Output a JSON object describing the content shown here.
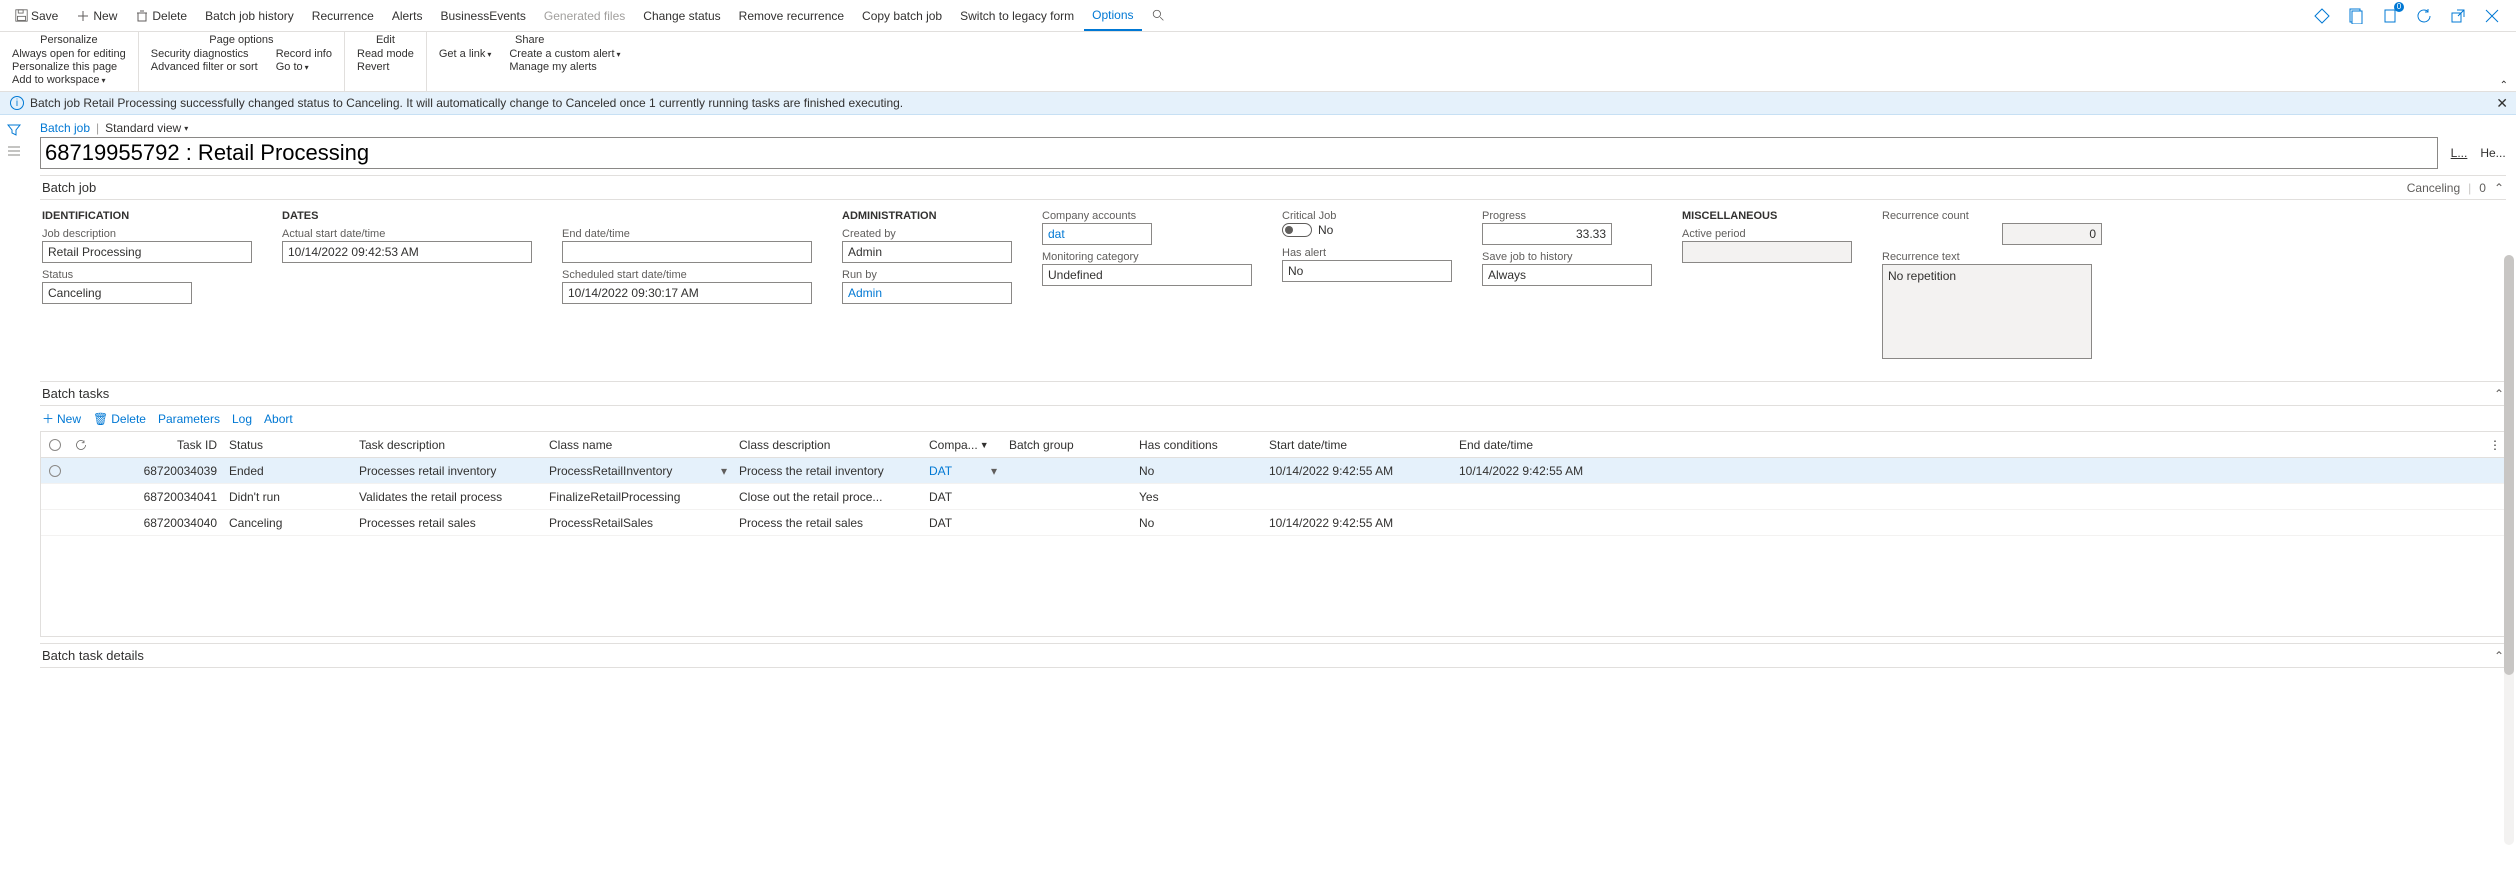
{
  "actionbar": {
    "save": "Save",
    "new": "New",
    "delete": "Delete",
    "history": "Batch job history",
    "recurrence": "Recurrence",
    "alerts": "Alerts",
    "businessEvents": "BusinessEvents",
    "generatedFiles": "Generated files",
    "changeStatus": "Change status",
    "removeRecurrence": "Remove recurrence",
    "copy": "Copy batch job",
    "switch": "Switch to legacy form",
    "options": "Options"
  },
  "ribbon": {
    "personalize": {
      "title": "Personalize",
      "alwaysOpen": "Always open for editing",
      "personalizePage": "Personalize this page",
      "addWorkspace": "Add to workspace"
    },
    "pageOptions": {
      "title": "Page options",
      "securityDiag": "Security diagnostics",
      "advancedFilter": "Advanced filter or sort",
      "recordInfo": "Record info",
      "goTo": "Go to"
    },
    "edit": {
      "title": "Edit",
      "readMode": "Read mode",
      "revert": "Revert"
    },
    "share": {
      "title": "Share",
      "getLink": "Get a link",
      "customAlert": "Create a custom alert",
      "manageAlerts": "Manage my alerts"
    }
  },
  "message": "Batch job Retail Processing successfully changed status to Canceling. It will automatically change to Canceled once 1 currently running tasks are finished executing.",
  "breadcrumb": {
    "link": "Batch job",
    "view": "Standard view"
  },
  "title": "68719955792 : Retail Processing",
  "titleActions": {
    "lookup": "L...",
    "help": "He..."
  },
  "fasttab1": {
    "title": "Batch job",
    "summaryStatus": "Canceling",
    "summaryCount": "0",
    "identification": {
      "head": "IDENTIFICATION",
      "jobDescLabel": "Job description",
      "jobDesc": "Retail Processing",
      "statusLabel": "Status",
      "status": "Canceling"
    },
    "dates": {
      "head": "DATES",
      "actualLabel": "Actual start date/time",
      "actual": "10/14/2022 09:42:53 AM",
      "endLabel": "End date/time",
      "end": "",
      "scheduledLabel": "Scheduled start date/time",
      "scheduled": "10/14/2022 09:30:17 AM"
    },
    "admin": {
      "head": "ADMINISTRATION",
      "createdByLabel": "Created by",
      "createdBy": "Admin",
      "runByLabel": "Run by",
      "runBy": "Admin",
      "companyLabel": "Company accounts",
      "company": "dat",
      "monitoringLabel": "Monitoring category",
      "monitoring": "Undefined",
      "criticalLabel": "Critical Job",
      "criticalVal": "No",
      "hasAlertLabel": "Has alert",
      "hasAlert": "No",
      "progressLabel": "Progress",
      "progress": "33.33",
      "saveLogLabel": "Save job to history",
      "saveLog": "Always"
    },
    "misc": {
      "head": "MISCELLANEOUS",
      "activePeriodLabel": "Active period",
      "activePeriod": "",
      "recurCountLabel": "Recurrence count",
      "recurCount": "0",
      "recurTextLabel": "Recurrence text",
      "recurText": "No repetition"
    }
  },
  "batchTasks": {
    "title": "Batch tasks",
    "toolbar": {
      "new": "New",
      "delete": "Delete",
      "parameters": "Parameters",
      "log": "Log",
      "abort": "Abort"
    },
    "columns": {
      "taskId": "Task ID",
      "status": "Status",
      "taskDesc": "Task description",
      "className": "Class name",
      "classDesc": "Class description",
      "company": "Compa...",
      "batchGroup": "Batch group",
      "hasCond": "Has conditions",
      "start": "Start date/time",
      "end": "End date/time"
    },
    "rows": [
      {
        "taskId": "68720034039",
        "status": "Ended",
        "taskDesc": "Processes retail inventory",
        "className": "ProcessRetailInventory",
        "classDesc": "Process the retail inventory",
        "company": "DAT",
        "batchGroup": "",
        "hasCond": "No",
        "start": "10/14/2022 9:42:55 AM",
        "end": "10/14/2022 9:42:55 AM"
      },
      {
        "taskId": "68720034041",
        "status": "Didn't run",
        "taskDesc": "Validates the retail process",
        "className": "FinalizeRetailProcessing",
        "classDesc": "Close out the retail proce...",
        "company": "DAT",
        "batchGroup": "",
        "hasCond": "Yes",
        "start": "",
        "end": ""
      },
      {
        "taskId": "68720034040",
        "status": "Canceling",
        "taskDesc": "Processes retail sales",
        "className": "ProcessRetailSales",
        "classDesc": "Process the retail sales",
        "company": "DAT",
        "batchGroup": "",
        "hasCond": "No",
        "start": "10/14/2022 9:42:55 AM",
        "end": ""
      }
    ]
  },
  "details": {
    "title": "Batch task details"
  },
  "notifBadge": "0"
}
